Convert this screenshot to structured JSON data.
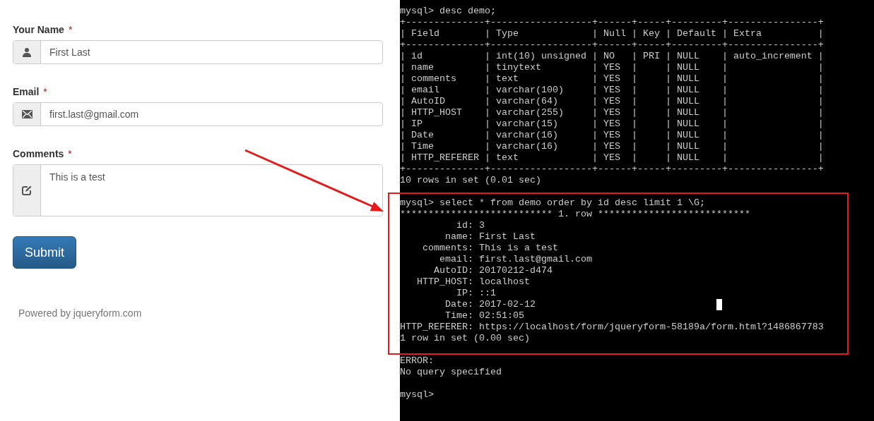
{
  "form": {
    "fields": [
      {
        "kind": "input",
        "label": "Your Name",
        "required_mark": "*",
        "value": "First Last"
      },
      {
        "kind": "input",
        "label": "Email",
        "required_mark": "*",
        "value": "first.last@gmail.com"
      },
      {
        "kind": "textarea",
        "label": "Comments",
        "required_mark": "*",
        "value": "This is a test"
      }
    ],
    "submit": "Submit",
    "footer": "Powered by jqueryform.com"
  },
  "terminal": {
    "blocks": [
      [
        "mysql> desc demo;",
        "+--------------+------------------+------+-----+---------+----------------+",
        "| Field        | Type             | Null | Key | Default | Extra          |",
        "+--------------+------------------+------+-----+---------+----------------+",
        "| id           | int(10) unsigned | NO   | PRI | NULL    | auto_increment |",
        "| name         | tinytext         | YES  |     | NULL    |                |",
        "| comments     | text             | YES  |     | NULL    |                |",
        "| email        | varchar(100)     | YES  |     | NULL    |                |",
        "| AutoID       | varchar(64)      | YES  |     | NULL    |                |",
        "| HTTP_HOST    | varchar(255)     | YES  |     | NULL    |                |",
        "| IP           | varchar(15)      | YES  |     | NULL    |                |",
        "| Date         | varchar(16)      | YES  |     | NULL    |                |",
        "| Time         | varchar(16)      | YES  |     | NULL    |                |",
        "| HTTP_REFERER | text             | YES  |     | NULL    |                |",
        "+--------------+------------------+------+-----+---------+----------------+",
        "10 rows in set (0.01 sec)"
      ],
      [
        "mysql> select * from demo order by id desc limit 1 \\G;",
        "*************************** 1. row ***************************",
        "          id: 3",
        "        name: First Last",
        "    comments: This is a test",
        "       email: first.last@gmail.com",
        "      AutoID: 20170212-d474",
        "   HTTP_HOST: localhost",
        "          IP: ::1",
        "        Date: 2017-02-12",
        "        Time: 02:51:05",
        "HTTP_REFERER: https://localhost/form/jqueryform-58189a/form.html?1486867783",
        "1 row in set (0.00 sec)"
      ],
      [
        "ERROR:",
        "No query specified"
      ],
      [
        "mysql>"
      ]
    ]
  }
}
